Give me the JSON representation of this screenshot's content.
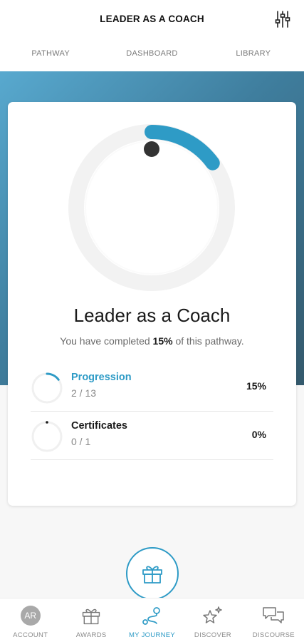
{
  "header": {
    "title": "LEADER AS A COACH",
    "filter_icon": "sliders-icon"
  },
  "tabs": [
    {
      "label": "PATHWAY",
      "active": false
    },
    {
      "label": "DASHBOARD",
      "active": true
    },
    {
      "label": "LIBRARY",
      "active": false
    }
  ],
  "dashboard": {
    "title": "Leader as a Coach",
    "subtitle_prefix": "You have completed ",
    "subtitle_percent": "15%",
    "subtitle_suffix": " of this pathway.",
    "progress_fraction": 0.15,
    "stats": [
      {
        "label": "Progression",
        "count": "2 / 13",
        "percent": "15%",
        "fraction": 0.15,
        "color": "#2e9bc6"
      },
      {
        "label": "Certificates",
        "count": "0 / 1",
        "percent": "0%",
        "fraction": 0,
        "color": "#1a1a1a"
      }
    ]
  },
  "fab": {
    "icon": "gift-icon"
  },
  "bottom_nav": [
    {
      "label": "ACCOUNT",
      "icon": "avatar",
      "avatar_text": "AR",
      "active": false
    },
    {
      "label": "AWARDS",
      "icon": "gift-icon",
      "active": false
    },
    {
      "label": "MY JOURNEY",
      "icon": "journey-icon",
      "active": true
    },
    {
      "label": "DISCOVER",
      "icon": "sparkle-star-icon",
      "active": false
    },
    {
      "label": "DISCOURSE",
      "icon": "chat-bubbles-icon",
      "active": false
    }
  ],
  "colors": {
    "accent": "#2e9bc6",
    "hero_start": "#58a9cf",
    "hero_end": "#34596c"
  }
}
